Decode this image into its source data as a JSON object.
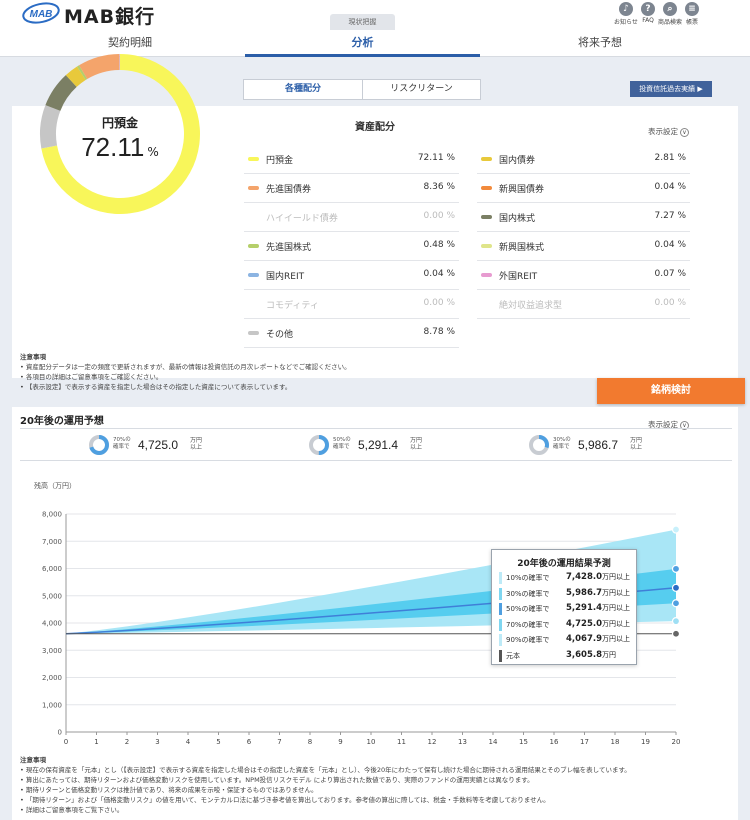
{
  "header": {
    "logo_text": "MAB銀行",
    "logo_mark": "MAB",
    "tab_label": "現状把握",
    "icons": [
      {
        "name": "bell-icon",
        "glyph": "♪",
        "label": "お知らせ"
      },
      {
        "name": "help-icon",
        "glyph": "?",
        "label": "FAQ"
      },
      {
        "name": "search-icon",
        "glyph": "⌕",
        "label": "商品検索"
      },
      {
        "name": "document-icon",
        "glyph": "≡",
        "label": "帳票"
      }
    ]
  },
  "nav": {
    "tabs": [
      "契約明細",
      "分析",
      "将来予想"
    ],
    "active": 1
  },
  "subtabs": {
    "tabs": [
      "各種配分",
      "リスクリターン"
    ],
    "active": 0
  },
  "fund_button": "投資信託過去実績 ▶",
  "allocation": {
    "title": "資産配分",
    "setting_label": "表示設定",
    "donut_label": "円預金",
    "donut_value": "72.11",
    "donut_unit": "%",
    "left_items": [
      {
        "name": "円預金",
        "pct": "72.11 %",
        "color": "#f8f65a",
        "value": 72.11
      },
      {
        "name": "先進国債券",
        "pct": "8.36 %",
        "color": "#f4a46b",
        "value": 8.36
      },
      {
        "name": "ハイイールド債券",
        "pct": "0.00 %",
        "color": "",
        "value": 0,
        "dim": true
      },
      {
        "name": "先進国株式",
        "pct": "0.48 %",
        "color": "#b5cf6a",
        "value": 0.48
      },
      {
        "name": "国内REIT",
        "pct": "0.04 %",
        "color": "#8cb4e2",
        "value": 0.04
      },
      {
        "name": "コモディティ",
        "pct": "0.00 %",
        "color": "",
        "value": 0,
        "dim": true
      },
      {
        "name": "その他",
        "pct": "8.78 %",
        "color": "#c6c6c6",
        "value": 8.78
      }
    ],
    "right_items": [
      {
        "name": "国内債券",
        "pct": "2.81 %",
        "color": "#e8c93b",
        "value": 2.81
      },
      {
        "name": "新興国債券",
        "pct": "0.04 %",
        "color": "#f28a3c",
        "value": 0.04
      },
      {
        "name": "国内株式",
        "pct": "7.27 %",
        "color": "#7b7f64",
        "value": 7.27
      },
      {
        "name": "新興国株式",
        "pct": "0.04 %",
        "color": "#dfe58a",
        "value": 0.04
      },
      {
        "name": "外国REIT",
        "pct": "0.07 %",
        "color": "#e79bd0",
        "value": 0.07
      },
      {
        "name": "絶対収益追求型",
        "pct": "0.00 %",
        "color": "",
        "value": 0,
        "dim": true
      }
    ],
    "notes_title": "注意事項",
    "notes": [
      "資産配分データは一定の頻度で更新されますが、最新の情報は投資信託の月次レポートなどでご確認ください。",
      "各項目の詳細はご留意事項をご確認ください。",
      "【表示設定】で表示する資産を指定した場合はその指定した資産について表示しています。"
    ]
  },
  "brand_button": "銘柄検討",
  "forecast": {
    "title": "20年後の運用予想",
    "setting_label": "表示設定",
    "summary": [
      {
        "prob": "70%の\n確率で",
        "value": "4,725.0",
        "unit": "万円\n以上",
        "share": 0.7
      },
      {
        "prob": "50%の\n確率で",
        "value": "5,291.4",
        "unit": "万円\n以上",
        "share": 0.5
      },
      {
        "prob": "30%の\n確率で",
        "value": "5,986.7",
        "unit": "万円\n以上",
        "share": 0.3
      }
    ],
    "tooltip": {
      "title": "20年後の運用結果予測",
      "rows": [
        {
          "label": "10%の確率で",
          "value": "7,428.0",
          "unit": "万円以上",
          "color": "#bdeaf7"
        },
        {
          "label": "30%の確率で",
          "value": "5,986.7",
          "unit": "万円以上",
          "color": "#7fd6f0"
        },
        {
          "label": "50%の確率で",
          "value": "5,291.4",
          "unit": "万円以上",
          "color": "#4f9fe0"
        },
        {
          "label": "70%の確率で",
          "value": "4,725.0",
          "unit": "万円以上",
          "color": "#7fd6f0"
        },
        {
          "label": "90%の確率で",
          "value": "4,067.9",
          "unit": "万円以上",
          "color": "#bdeaf7"
        },
        {
          "label": "元本",
          "value": "3,605.8",
          "unit": "万円",
          "color": "#555555"
        }
      ]
    },
    "notes_title": "注意事項",
    "notes": [
      "現在の保有資産を「元本」とし（【表示設定】で表示する資産を指定した場合はその指定した資産を「元本」とし）、今後20年にわたって保有し続けた場合に期待される運用結果とそのブレ幅を表しています。",
      "算出にあたっては、期待リターンおよび価格変動リスクを使用しています。NPM投信リスクモデル により算出された数値であり、実際のファンドの運用実績とは異なります。",
      "期待リターンと価格変動リスクは推計値であり、将来の成果を示唆・保証するものではありません。",
      "「期待リターン」および「価格変動リスク」の値を用いて、モンテカルロ法に基づき参考値を算出しております。参考値の算出に際しては、税金・手数料等を考慮しておりません。",
      "詳細はご留意事項をご覧下さい。"
    ]
  },
  "chart_data": {
    "type": "area",
    "ylabel": "残高（万円）",
    "x": [
      0,
      1,
      2,
      3,
      4,
      5,
      6,
      7,
      8,
      9,
      10,
      11,
      12,
      13,
      14,
      15,
      16,
      17,
      18,
      19,
      20
    ],
    "ylim": [
      0,
      8000
    ],
    "yticks": [
      0,
      1000,
      2000,
      3000,
      4000,
      5000,
      6000,
      7000,
      8000
    ],
    "ytick_labels": [
      "0",
      "1,000",
      "2,000",
      "3,000",
      "4,000",
      "5,000",
      "6,000",
      "7,000",
      "8,000"
    ],
    "grid": true,
    "start": 3605.8,
    "end_values": {
      "p10": 7428.0,
      "p30": 5986.7,
      "p50": 5291.4,
      "p70": 4725.0,
      "p90": 4067.9,
      "principal": 3605.8
    },
    "colors": {
      "outer": "#a9e6f6",
      "inner": "#56cdef",
      "median": "#3f7fd8",
      "principal": "#555555"
    }
  }
}
